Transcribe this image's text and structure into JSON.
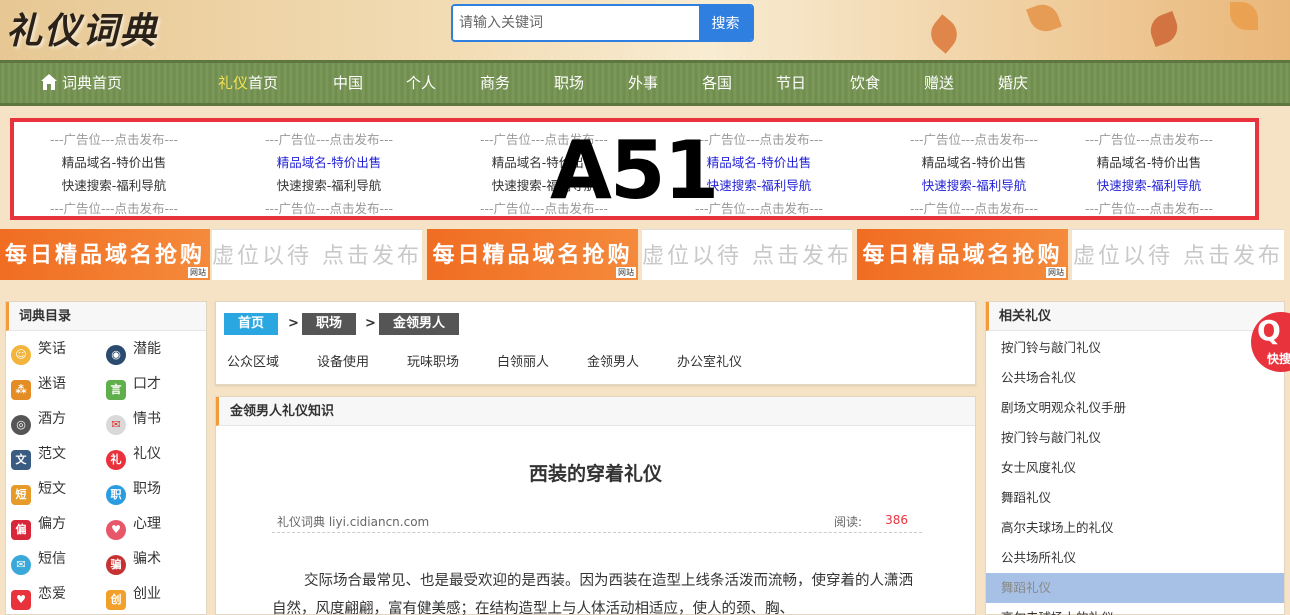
{
  "header": {
    "logo_text": "礼仪词典",
    "search_placeholder": "请输入关键词",
    "search_button": "搜索"
  },
  "nav": {
    "home": "词典首页",
    "items": [
      {
        "hl": "礼仪",
        "rest": "首页"
      },
      {
        "label": "中国"
      },
      {
        "label": "个人"
      },
      {
        "label": "商务"
      },
      {
        "label": "职场"
      },
      {
        "label": "外事"
      },
      {
        "label": "各国"
      },
      {
        "label": "节日"
      },
      {
        "label": "饮食"
      },
      {
        "label": "赠送"
      },
      {
        "label": "婚庆"
      }
    ]
  },
  "ads": {
    "placeholder": "---广告位---点击发布---",
    "domain_sale": "精品域名-特价出售",
    "fast_search": "快速搜索-福利导航",
    "overlay_label": "A51"
  },
  "banners": {
    "orange_text": "每日精品域名抢购",
    "white_text": "虚位以待 点击发布",
    "tag_text": "网站"
  },
  "left_panel": {
    "title": "词典目录",
    "categories": [
      "笑话",
      "潜能",
      "迷语",
      "口才",
      "酒方",
      "情书",
      "范文",
      "礼仪",
      "短文",
      "职场",
      "偏方",
      "心理",
      "短信",
      "骗术",
      "恋爱",
      "创业"
    ]
  },
  "breadcrumb": {
    "home": "首页",
    "sep": ">",
    "level1": "职场",
    "level2": "金领男人"
  },
  "subnav": [
    "公众区域",
    "设备使用",
    "玩味职场",
    "白领丽人",
    "金领男人",
    "办公室礼仪"
  ],
  "article": {
    "section_title": "金领男人礼仪知识",
    "title": "西装的穿着礼仪",
    "source": "礼仪词典 liyi.cidiancn.com",
    "read_label": "阅读:",
    "read_count": "386",
    "paragraph": "交际场合最常见、也是最受欢迎的是西装。因为西装在造型上线条活泼而流畅，使穿着的人潇洒自然，风度翩翩，富有健美感；在结构造型上与人体活动相适应，使人的颈、胸、"
  },
  "right_panel": {
    "title": "相关礼仪",
    "items": [
      "按门铃与敲门礼仪",
      "公共场合礼仪",
      "剧场文明观众礼仪手册",
      "按门铃与敲门礼仪",
      "女士风度礼仪",
      "舞蹈礼仪",
      "高尔夫球场上的礼仪",
      "公共场所礼仪",
      "舞蹈礼仪",
      "高尔夫球场上的礼仪"
    ]
  },
  "float_button": {
    "symbol": "Q",
    "label": "快搜"
  },
  "colors": {
    "accent_blue": "#2f7fe0",
    "nav_green": "#6f8b4e",
    "ad_red_border": "#e8333d",
    "banner_orange": "#f06d22",
    "nav_highlight": "#f5e050"
  }
}
